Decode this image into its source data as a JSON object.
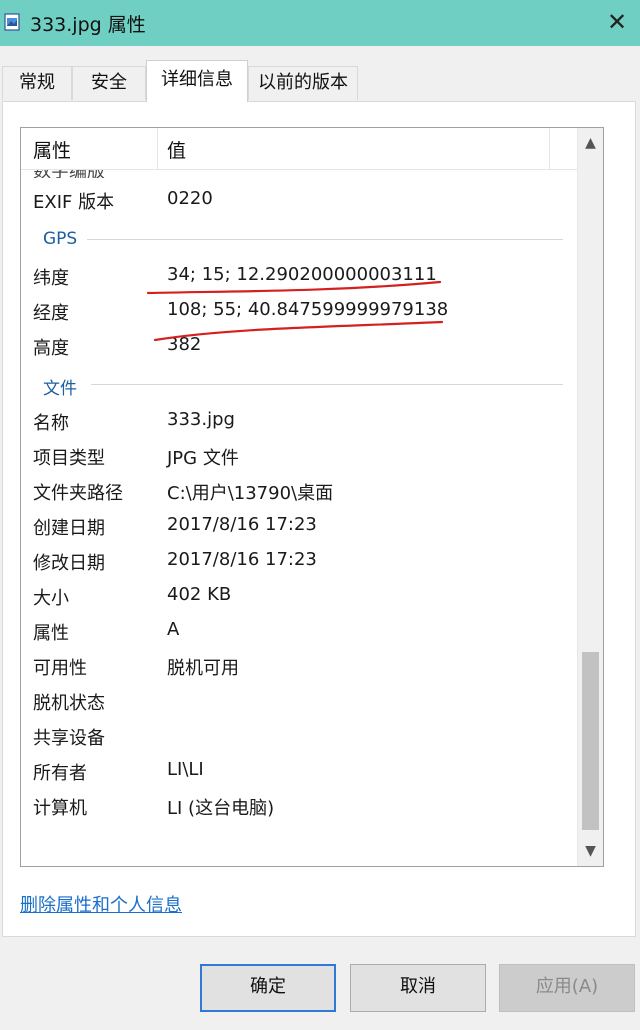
{
  "window": {
    "title": "333.jpg 属性",
    "icon": "image-file-icon",
    "close_glyph": "✕"
  },
  "tabs": [
    {
      "label": "常规",
      "active": false
    },
    {
      "label": "安全",
      "active": false
    },
    {
      "label": "详细信息",
      "active": true
    },
    {
      "label": "以前的版本",
      "active": false
    }
  ],
  "details": {
    "col_property": "属性",
    "col_value": "值",
    "cut_row": "数字编版",
    "exif": {
      "label": "EXIF 版本",
      "value": "0220"
    },
    "groups": [
      {
        "title": "GPS",
        "rows": [
          {
            "label": "纬度",
            "value": "34; 15; 12.290200000003111"
          },
          {
            "label": "经度",
            "value": "108; 55; 40.847599999979138"
          },
          {
            "label": "高度",
            "value": "382"
          }
        ]
      },
      {
        "title": "文件",
        "rows": [
          {
            "label": "名称",
            "value": "333.jpg"
          },
          {
            "label": "项目类型",
            "value": "JPG 文件"
          },
          {
            "label": "文件夹路径",
            "value": "C:\\用户\\13790\\桌面"
          },
          {
            "label": "创建日期",
            "value": "2017/8/16 17:23"
          },
          {
            "label": "修改日期",
            "value": "2017/8/16 17:23"
          },
          {
            "label": "大小",
            "value": "402 KB"
          },
          {
            "label": "属性",
            "value": "A"
          },
          {
            "label": "可用性",
            "value": "脱机可用"
          },
          {
            "label": "脱机状态",
            "value": ""
          },
          {
            "label": "共享设备",
            "value": ""
          },
          {
            "label": "所有者",
            "value": "LI\\LI"
          },
          {
            "label": "计算机",
            "value": "LI (这台电脑)"
          }
        ]
      }
    ]
  },
  "scroll": {
    "up_glyph": "▲",
    "down_glyph": "▼"
  },
  "remove_link": "删除属性和个人信息",
  "buttons": {
    "ok": "确定",
    "cancel": "取消",
    "apply": "应用(A)"
  },
  "colors": {
    "titlebar": "#6fcfc2",
    "group_title": "#1c5fa3",
    "link": "#1a6fc9",
    "annotation": "#d42020"
  }
}
